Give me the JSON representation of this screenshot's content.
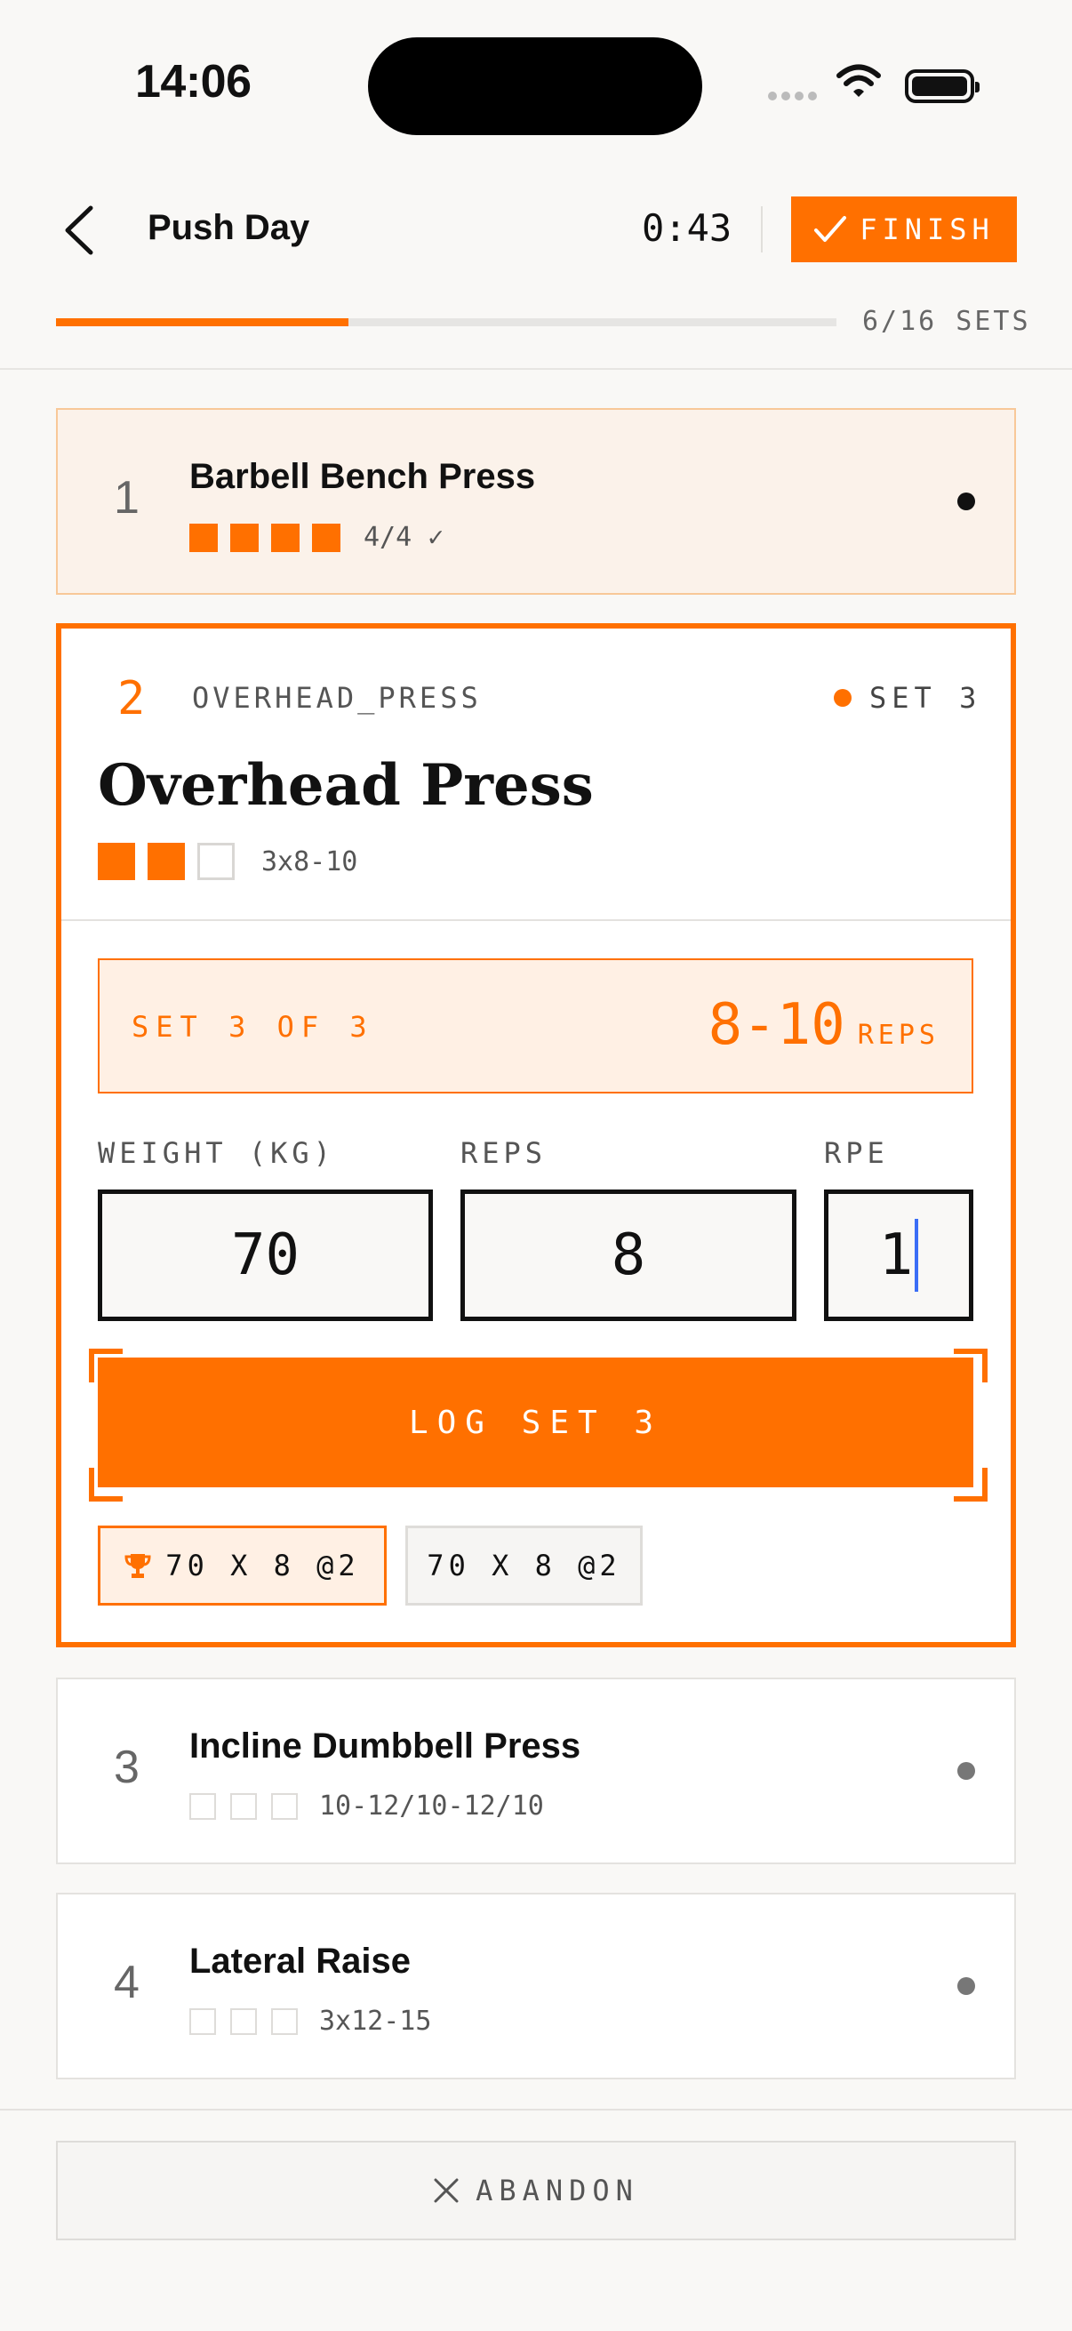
{
  "status_bar": {
    "time": "14:06"
  },
  "header": {
    "title": "Push Day",
    "timer": "0:43",
    "finish_label": "FINISH",
    "progress_label": "6/16 SETS",
    "progress_fraction": 0.375
  },
  "exercises": [
    {
      "number": "1",
      "name": "Barbell Bench Press",
      "summary": "4/4 ✓"
    },
    {
      "number": "2",
      "code": "OVERHEAD_PRESS",
      "status": "SET 3",
      "name": "Overhead Press",
      "scheme": "3x8-10",
      "set_banner": {
        "label": "SET 3 OF 3",
        "range": "8-10",
        "unit": "REPS"
      },
      "fields": {
        "weight_label": "WEIGHT (KG)",
        "weight_value": "70",
        "reps_label": "REPS",
        "reps_value": "8",
        "rpe_label": "RPE",
        "rpe_value": "1"
      },
      "log_label": "LOG SET 3",
      "history": [
        "70 X 8 @2",
        "70 X 8 @2"
      ]
    },
    {
      "number": "3",
      "name": "Incline Dumbbell Press",
      "scheme": "10-12/10-12/10"
    },
    {
      "number": "4",
      "name": "Lateral Raise",
      "scheme": "3x12-15"
    }
  ],
  "footer": {
    "abandon_label": "ABANDON"
  },
  "colors": {
    "accent": "#ff7000",
    "done_bg": "#fbf2ea",
    "caret": "#3b6ef6"
  }
}
